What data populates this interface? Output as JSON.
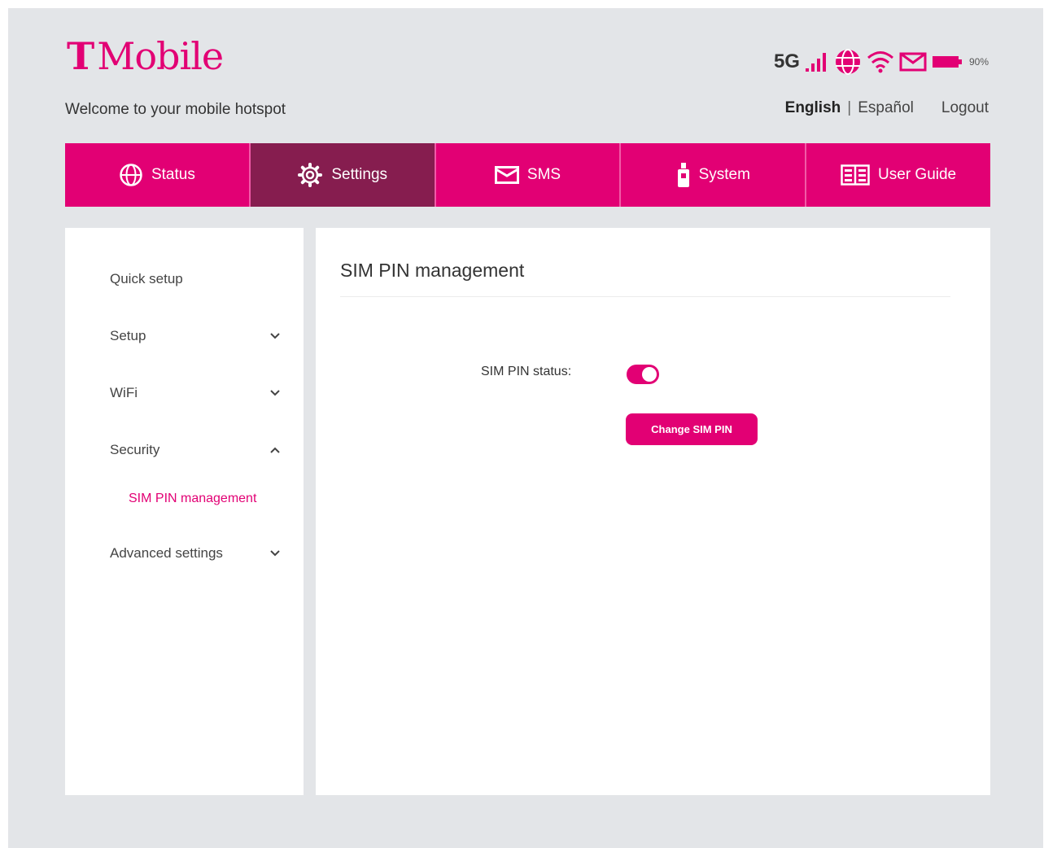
{
  "brand": {
    "logo_t": "T",
    "logo_word": "Mobile",
    "color": "#e20074"
  },
  "header": {
    "welcome": "Welcome to your mobile hotspot",
    "network": "5G",
    "battery_percent": "90%",
    "lang_english": "English",
    "lang_separator": "|",
    "lang_spanish": "Español",
    "logout": "Logout"
  },
  "nav": {
    "items": [
      {
        "label": "Status",
        "icon": "globe-icon"
      },
      {
        "label": "Settings",
        "icon": "gear-icon",
        "active": true
      },
      {
        "label": "SMS",
        "icon": "envelope-icon"
      },
      {
        "label": "System",
        "icon": "device-icon"
      },
      {
        "label": "User Guide",
        "icon": "book-icon"
      }
    ]
  },
  "sidebar": {
    "items": [
      {
        "label": "Quick setup"
      },
      {
        "label": "Setup",
        "chevron": "down"
      },
      {
        "label": "WiFi",
        "chevron": "down"
      },
      {
        "label": "Security",
        "chevron": "up"
      },
      {
        "label": "Advanced settings",
        "chevron": "down"
      }
    ],
    "active_sub": "SIM PIN management"
  },
  "main": {
    "title": "SIM PIN management",
    "pin_status_label": "SIM PIN status:",
    "pin_status_on": true,
    "change_button": "Change SIM PIN"
  },
  "colors": {
    "accent": "#e20074",
    "active_tab": "#861d4f",
    "background": "#e3e5e8"
  }
}
